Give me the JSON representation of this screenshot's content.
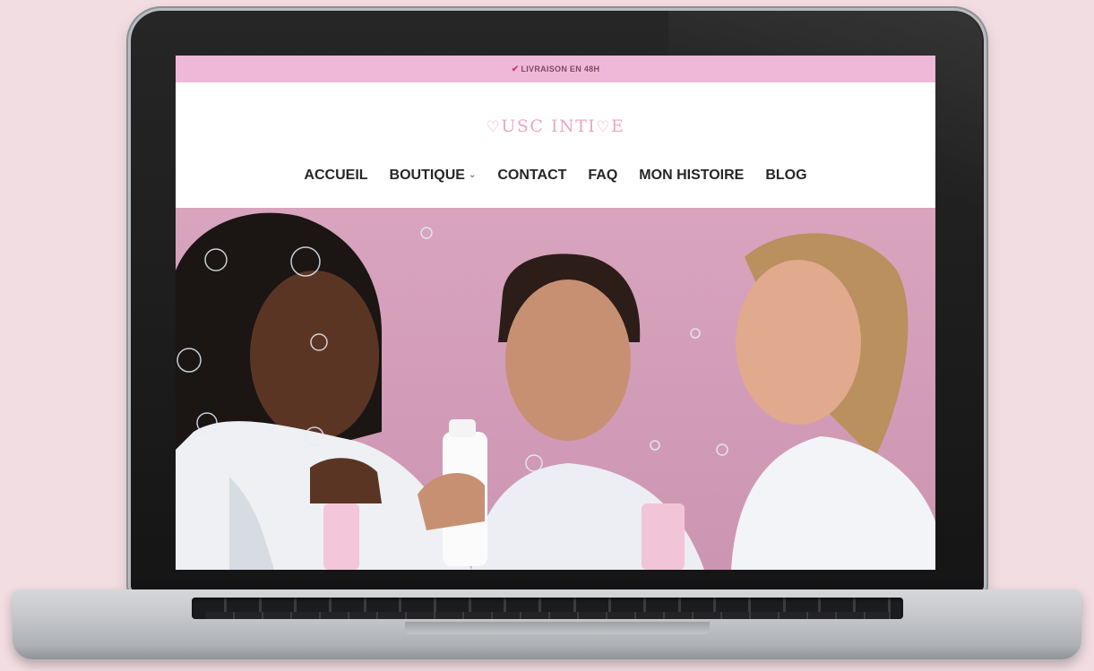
{
  "announcement": {
    "check_icon": "check-icon",
    "text": "LIVRAISON EN 48H"
  },
  "brand": {
    "logo_text": "MUSC INTIME",
    "logo_prefix": "USC INTI",
    "logo_suffix": "E"
  },
  "nav": {
    "items": [
      {
        "label": "ACCUEIL"
      },
      {
        "label": "BOUTIQUE",
        "has_dropdown": true
      },
      {
        "label": "CONTACT"
      },
      {
        "label": "FAQ"
      },
      {
        "label": "MON HISTOIRE"
      },
      {
        "label": "BLOG"
      }
    ]
  },
  "hero": {
    "background": "#d5a0bb",
    "subject": "three-women-holding-cosmetic-bottles"
  },
  "colors": {
    "accent_pink": "#f0b8d8",
    "logo_pink": "#eaa7c3",
    "backdrop": "#f1dde2"
  }
}
